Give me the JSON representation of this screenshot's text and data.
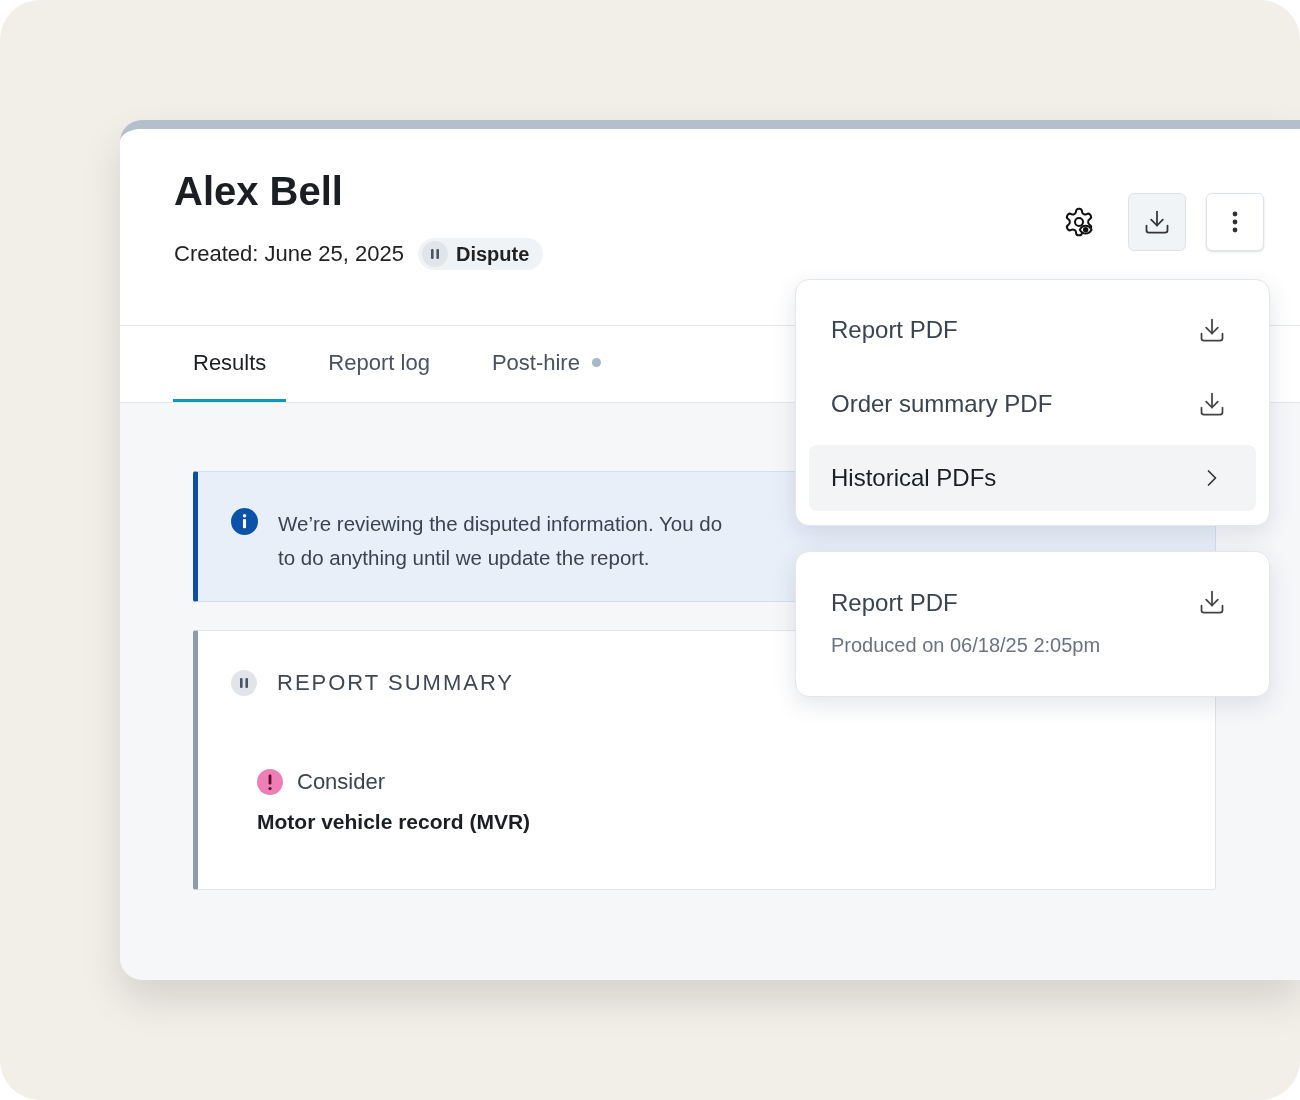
{
  "header": {
    "name": "Alex Bell",
    "created": "Created: June 25, 2025",
    "status_badge": "Dispute"
  },
  "toolbar": [
    {
      "kind": "settings"
    },
    {
      "kind": "download",
      "expanded": true
    },
    {
      "kind": "more",
      "expanded": false
    }
  ],
  "tabs": [
    {
      "label": "Results",
      "selected": true,
      "dot": false
    },
    {
      "label": "Report log",
      "selected": false,
      "dot": false
    },
    {
      "label": "Post-hire",
      "selected": false,
      "dot": true
    }
  ],
  "alert": {
    "lines": [
      "We’re reviewing the disputed information. You do",
      "to do anything until we update the report."
    ]
  },
  "report_summary": {
    "title": "REPORT SUMMARY",
    "items": [
      {
        "status": "Consider",
        "name": "Motor vehicle record (MVR)"
      }
    ]
  },
  "download_menu": {
    "items": [
      {
        "label": "Report PDF",
        "kind": "download",
        "selected": false
      },
      {
        "label": "Order summary PDF",
        "kind": "download",
        "selected": false
      },
      {
        "label": "Historical PDFs",
        "kind": "submenu",
        "selected": true
      }
    ]
  },
  "submenu": {
    "items": [
      {
        "label": "Report PDF",
        "detail": "Produced on 06/18/25 2:05pm"
      }
    ]
  }
}
